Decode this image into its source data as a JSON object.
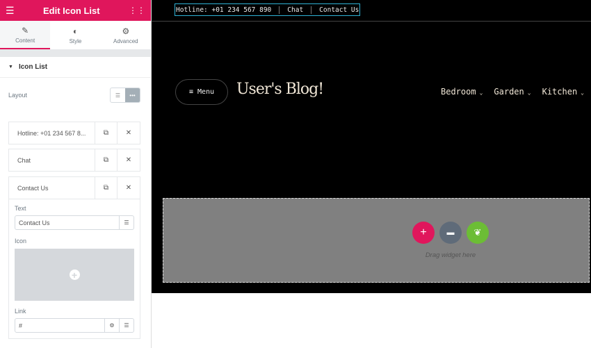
{
  "panel": {
    "title": "Edit Icon List",
    "tabs": [
      {
        "label": "Content"
      },
      {
        "label": "Style"
      },
      {
        "label": "Advanced"
      }
    ],
    "section": "Icon List",
    "layout_label": "Layout",
    "items": [
      {
        "label": "Hotline: +01 234 567 8..."
      },
      {
        "label": "Chat"
      },
      {
        "label": "Contact Us"
      }
    ],
    "text_label": "Text",
    "text_value": "Contact Us",
    "icon_label": "Icon",
    "link_label": "Link",
    "link_value": "#"
  },
  "site": {
    "topbar": [
      "Hotline: +01 234 567 890",
      "Chat",
      "Contact Us"
    ],
    "menu_label": "Menu",
    "logo": "User's Blog!",
    "nav": [
      {
        "label": "Bedroom"
      },
      {
        "label": "Garden"
      },
      {
        "label": "Kitchen"
      }
    ],
    "drop_text": "Drag widget here"
  },
  "colors": {
    "accent": "#e0165c",
    "selection": "#2fb3d6",
    "add": "#e0165c",
    "folder": "#5f6b79",
    "elementor": "#6cbd35"
  }
}
